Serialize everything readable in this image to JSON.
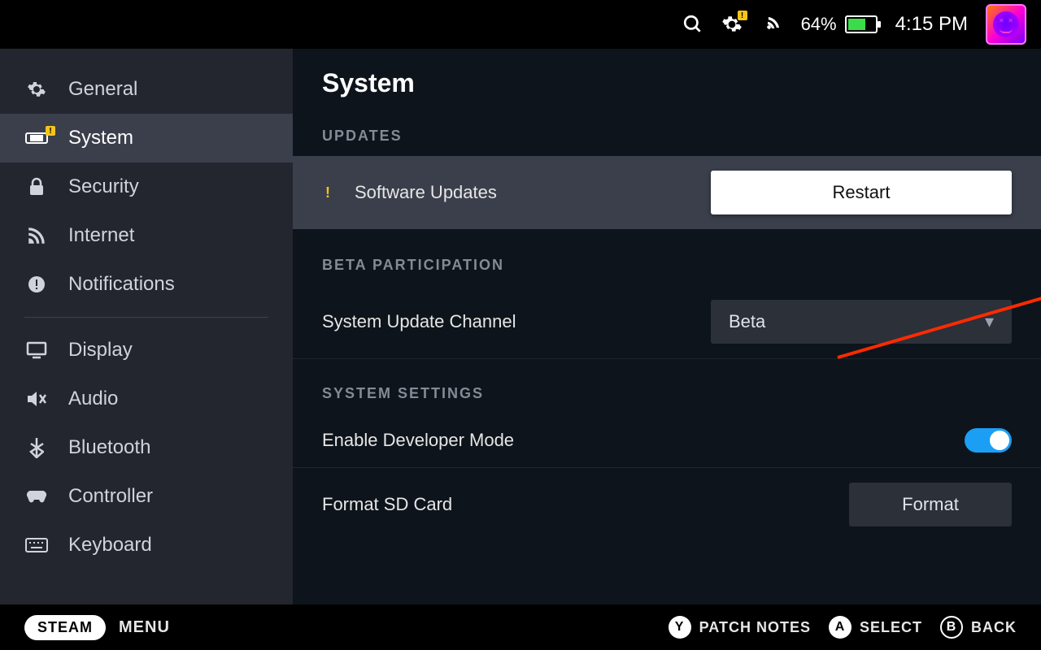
{
  "status": {
    "battery_pct": "64%",
    "clock": "4:15 PM"
  },
  "sidebar": {
    "items": [
      {
        "label": "General"
      },
      {
        "label": "System"
      },
      {
        "label": "Security"
      },
      {
        "label": "Internet"
      },
      {
        "label": "Notifications"
      },
      {
        "label": "Display"
      },
      {
        "label": "Audio"
      },
      {
        "label": "Bluetooth"
      },
      {
        "label": "Controller"
      },
      {
        "label": "Keyboard"
      }
    ]
  },
  "main": {
    "title": "System",
    "sections": {
      "updates_hdr": "UPDATES",
      "software_updates": "Software Updates",
      "restart_btn": "Restart",
      "beta_hdr": "BETA PARTICIPATION",
      "update_channel_lbl": "System Update Channel",
      "update_channel_val": "Beta",
      "settings_hdr": "SYSTEM SETTINGS",
      "dev_mode_lbl": "Enable Developer Mode",
      "format_sd_lbl": "Format SD Card",
      "format_btn": "Format"
    }
  },
  "footer": {
    "steam": "STEAM",
    "menu": "MENU",
    "hints": [
      {
        "key": "Y",
        "label": "PATCH NOTES"
      },
      {
        "key": "A",
        "label": "SELECT"
      },
      {
        "key": "B",
        "label": "BACK"
      }
    ]
  }
}
